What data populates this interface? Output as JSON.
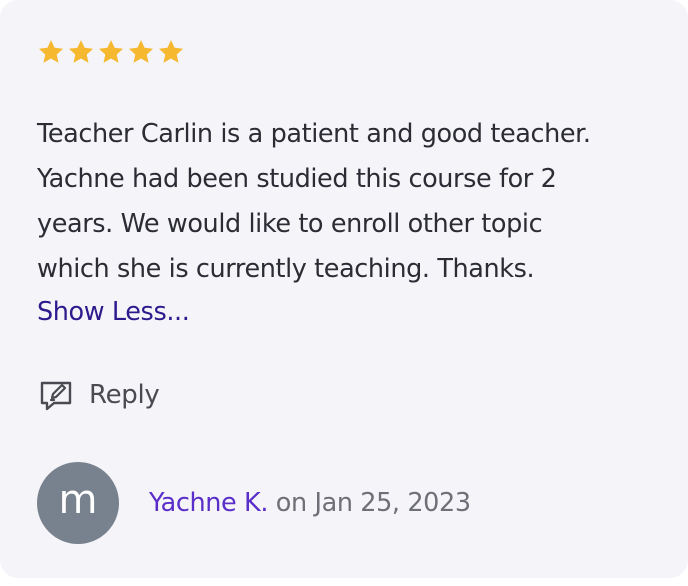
{
  "review": {
    "rating": 5,
    "rating_max": 5,
    "star_color": "#f5b82e",
    "text_lines": [
      "Teacher Carlin is a patient and good teacher.",
      "Yachne had been studied this course for 2",
      "years. We would like to enroll other topic",
      "which she is currently teaching. Thanks."
    ],
    "show_less_label": "Show Less...",
    "reply_label": "Reply",
    "reply_icon": "reply-edit-icon",
    "author": {
      "avatar_initial": "m",
      "avatar_color": "#78828e",
      "name": "Yachne K.",
      "separator": "on",
      "date": "Jan 25, 2023"
    }
  }
}
